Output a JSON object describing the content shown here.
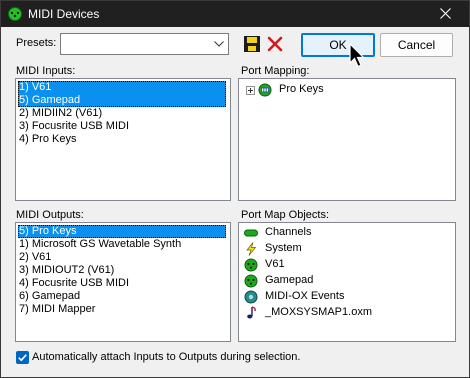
{
  "window": {
    "title": "MIDI Devices"
  },
  "presets": {
    "label": "Presets:",
    "value": ""
  },
  "buttons": {
    "ok": "OK",
    "cancel": "Cancel"
  },
  "midi_inputs": {
    "label": "MIDI Inputs:",
    "items": [
      {
        "text": "1) V61",
        "selected": true
      },
      {
        "text": "5) Gamepad",
        "selected": true
      },
      {
        "text": "2) MIDIIN2 (V61)",
        "selected": false
      },
      {
        "text": "3) Focusrite USB MIDI",
        "selected": false
      },
      {
        "text": "4) Pro Keys",
        "selected": false
      }
    ]
  },
  "port_mapping": {
    "label": "Port Mapping:",
    "items": [
      {
        "text": "Pro Keys",
        "icon": "keyboard-port-icon"
      }
    ]
  },
  "midi_outputs": {
    "label": "MIDI Outputs:",
    "items": [
      {
        "text": "5) Pro Keys",
        "selected": true
      },
      {
        "text": "1) Microsoft GS Wavetable Synth",
        "selected": false
      },
      {
        "text": "2) V61",
        "selected": false
      },
      {
        "text": "3) MIDIOUT2 (V61)",
        "selected": false
      },
      {
        "text": "4) Focusrite USB MIDI",
        "selected": false
      },
      {
        "text": "6) Gamepad",
        "selected": false
      },
      {
        "text": "7) MIDI Mapper",
        "selected": false
      }
    ]
  },
  "port_map_objects": {
    "label": "Port Map Objects:",
    "items": [
      {
        "text": "Channels",
        "icon": "channels-icon"
      },
      {
        "text": "System",
        "icon": "system-lightning-icon"
      },
      {
        "text": "V61",
        "icon": "midi-port-icon"
      },
      {
        "text": "Gamepad",
        "icon": "midi-port-icon"
      },
      {
        "text": "MIDI-OX Events",
        "icon": "midi-ox-events-icon"
      },
      {
        "text": "_MOXSYSMAP1.oxm",
        "icon": "music-note-file-icon"
      }
    ]
  },
  "auto_attach": {
    "label": "Automatically attach Inputs to Outputs during selection.",
    "checked": true
  },
  "colors": {
    "selection": "#0a91f0",
    "titlebar": "#202020",
    "midi_port_green": "#1fa81f",
    "checkbox": "#0067c0"
  }
}
